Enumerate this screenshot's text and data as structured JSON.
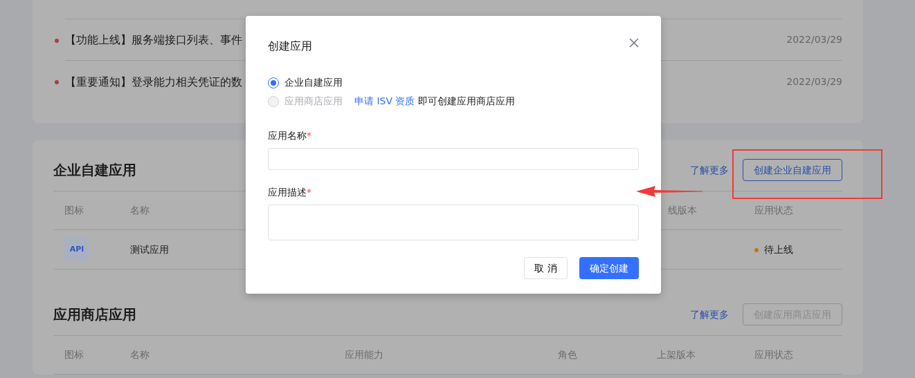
{
  "announcements": [
    {
      "text": "【功能上线】服务端接口列表、事件",
      "date": "2022/03/29"
    },
    {
      "text": "【重要通知】登录能力相关凭证的数",
      "date": "2022/03/29"
    }
  ],
  "sections": [
    {
      "title": "企业自建应用",
      "learn_more": "了解更多",
      "create_button": {
        "label": "创建企业自建应用",
        "disabled": false
      },
      "columns": [
        "图标",
        "名称",
        "线版本",
        "应用状态"
      ],
      "rows": [
        {
          "icon_text": "API",
          "name": "测试应用",
          "status": "待上线",
          "color": "#c47412"
        }
      ]
    },
    {
      "title": "应用商店应用",
      "learn_more": "了解更多",
      "create_button": {
        "label": "创建应用商店应用",
        "disabled": true
      },
      "columns": [
        "图标",
        "名称",
        "应用能力",
        "角色",
        "上架版本",
        "应用状态"
      ]
    }
  ],
  "modal": {
    "title": "创建应用",
    "options": [
      {
        "label": "企业自建应用",
        "selected": true,
        "disabled": false
      },
      {
        "label": "应用商店应用",
        "selected": false,
        "disabled": true,
        "link": "申请 ISV 资质",
        "note": "即可创建应用商店应用"
      }
    ],
    "fields": [
      {
        "label": "应用名称",
        "required_mark": "*",
        "kind": "input"
      },
      {
        "label": "应用描述",
        "required_mark": "*",
        "kind": "textarea"
      }
    ],
    "buttons": [
      {
        "label": "取 消",
        "kind": "secondary"
      },
      {
        "label": "确定创建",
        "kind": "primary"
      }
    ]
  }
}
